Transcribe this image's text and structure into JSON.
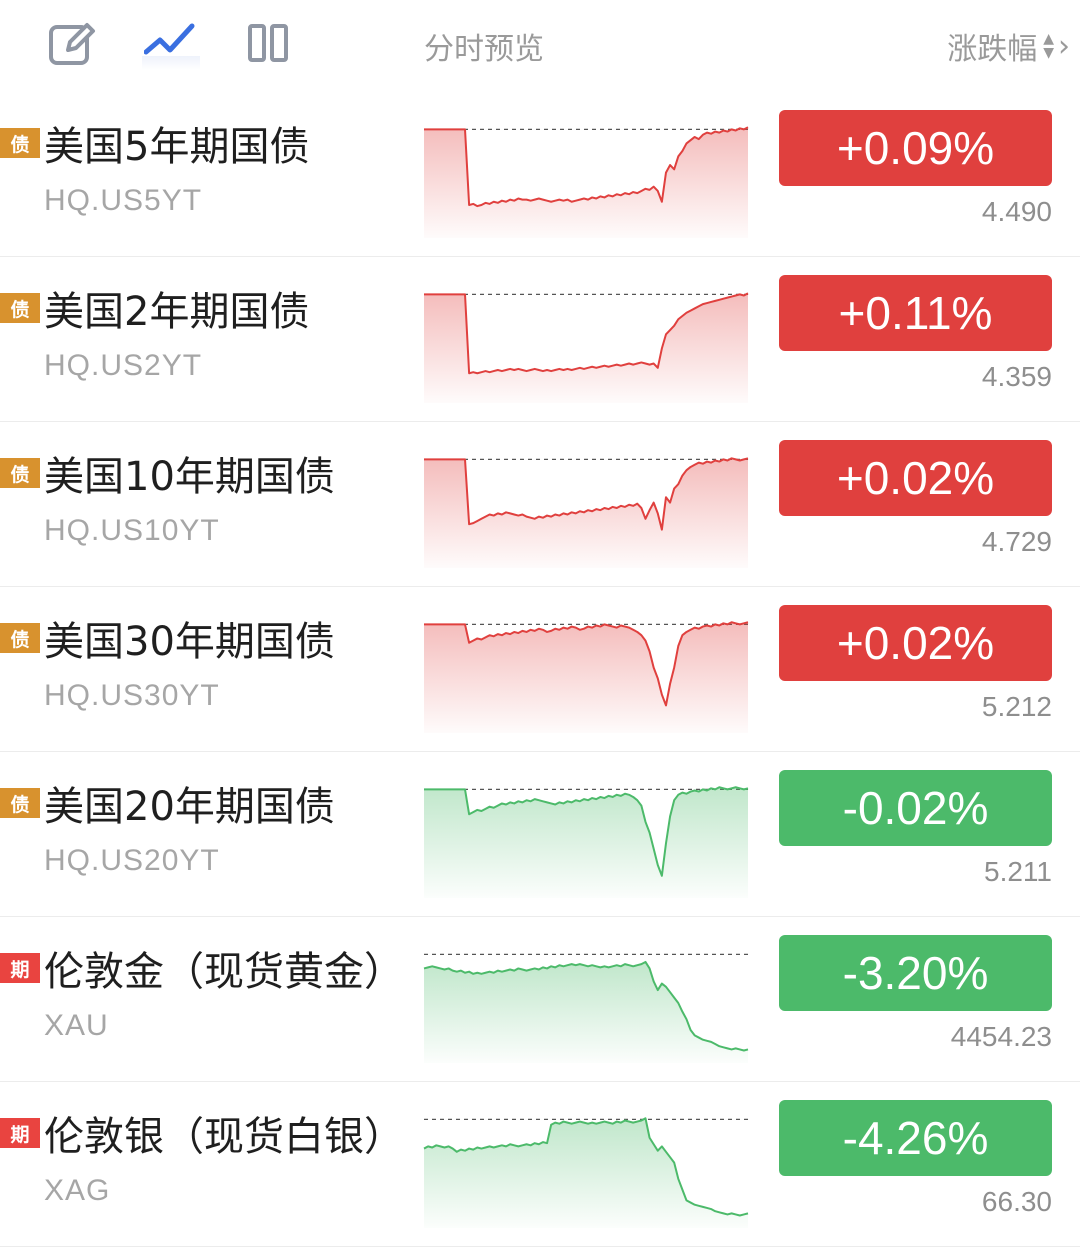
{
  "header": {
    "icons": [
      "edit-icon",
      "line-chart-icon",
      "columns-icon"
    ],
    "preview_label": "分时预览",
    "sort_label": "涨跌幅"
  },
  "colors": {
    "up": "#e0403e",
    "down": "#4cba6a",
    "bond_tag": "#d8922e",
    "futures_tag": "#e94440"
  },
  "rows": [
    {
      "tag": "债",
      "name": "美国5年期国债",
      "code": "HQ.US5YT",
      "change": "+0.09%",
      "price": "4.490",
      "direction": "up",
      "spark": [
        0.95,
        0.95,
        0.95,
        0.95,
        0.95,
        0.95,
        0.95,
        0.95,
        0.95,
        0.95,
        0.95,
        0.25,
        0.26,
        0.24,
        0.25,
        0.27,
        0.26,
        0.28,
        0.27,
        0.29,
        0.28,
        0.3,
        0.29,
        0.31,
        0.3,
        0.3,
        0.29,
        0.3,
        0.31,
        0.3,
        0.29,
        0.28,
        0.29,
        0.3,
        0.29,
        0.3,
        0.28,
        0.29,
        0.3,
        0.31,
        0.3,
        0.32,
        0.31,
        0.33,
        0.32,
        0.34,
        0.33,
        0.35,
        0.34,
        0.36,
        0.35,
        0.37,
        0.36,
        0.38,
        0.4,
        0.39,
        0.42,
        0.38,
        0.28,
        0.55,
        0.62,
        0.58,
        0.7,
        0.75,
        0.82,
        0.85,
        0.88,
        0.86,
        0.9,
        0.92,
        0.91,
        0.93,
        0.92,
        0.94,
        0.93,
        0.95,
        0.94,
        0.96,
        0.95,
        0.97
      ]
    },
    {
      "tag": "债",
      "name": "美国2年期国债",
      "code": "HQ.US2YT",
      "change": "+0.11%",
      "price": "4.359",
      "direction": "up",
      "spark": [
        0.95,
        0.95,
        0.95,
        0.95,
        0.95,
        0.95,
        0.95,
        0.95,
        0.95,
        0.95,
        0.95,
        0.22,
        0.23,
        0.22,
        0.23,
        0.24,
        0.23,
        0.24,
        0.25,
        0.24,
        0.25,
        0.26,
        0.25,
        0.26,
        0.25,
        0.24,
        0.25,
        0.26,
        0.25,
        0.24,
        0.25,
        0.24,
        0.25,
        0.26,
        0.25,
        0.26,
        0.25,
        0.26,
        0.27,
        0.26,
        0.27,
        0.28,
        0.27,
        0.28,
        0.29,
        0.28,
        0.29,
        0.3,
        0.29,
        0.3,
        0.31,
        0.3,
        0.31,
        0.32,
        0.31,
        0.3,
        0.31,
        0.27,
        0.45,
        0.58,
        0.62,
        0.66,
        0.72,
        0.75,
        0.78,
        0.8,
        0.82,
        0.84,
        0.86,
        0.87,
        0.88,
        0.89,
        0.9,
        0.91,
        0.92,
        0.93,
        0.94,
        0.95,
        0.94,
        0.96
      ]
    },
    {
      "tag": "债",
      "name": "美国10年期国债",
      "code": "HQ.US10YT",
      "change": "+0.02%",
      "price": "4.729",
      "direction": "up",
      "spark": [
        0.95,
        0.95,
        0.95,
        0.95,
        0.95,
        0.95,
        0.95,
        0.95,
        0.95,
        0.95,
        0.95,
        0.35,
        0.36,
        0.38,
        0.4,
        0.42,
        0.44,
        0.43,
        0.45,
        0.44,
        0.46,
        0.45,
        0.44,
        0.43,
        0.44,
        0.42,
        0.41,
        0.4,
        0.42,
        0.41,
        0.43,
        0.42,
        0.44,
        0.43,
        0.45,
        0.44,
        0.46,
        0.45,
        0.47,
        0.46,
        0.48,
        0.47,
        0.49,
        0.48,
        0.5,
        0.49,
        0.51,
        0.5,
        0.52,
        0.51,
        0.53,
        0.52,
        0.54,
        0.5,
        0.4,
        0.48,
        0.55,
        0.45,
        0.3,
        0.6,
        0.55,
        0.68,
        0.72,
        0.8,
        0.85,
        0.88,
        0.9,
        0.92,
        0.91,
        0.93,
        0.92,
        0.94,
        0.93,
        0.95,
        0.94,
        0.96,
        0.95,
        0.94,
        0.95,
        0.96
      ]
    },
    {
      "tag": "债",
      "name": "美国30年期国债",
      "code": "HQ.US30YT",
      "change": "+0.02%",
      "price": "5.212",
      "direction": "up",
      "spark": [
        0.95,
        0.95,
        0.95,
        0.95,
        0.95,
        0.95,
        0.95,
        0.95,
        0.95,
        0.95,
        0.95,
        0.78,
        0.8,
        0.82,
        0.81,
        0.83,
        0.85,
        0.84,
        0.86,
        0.85,
        0.87,
        0.86,
        0.88,
        0.87,
        0.89,
        0.88,
        0.9,
        0.89,
        0.91,
        0.9,
        0.88,
        0.89,
        0.91,
        0.9,
        0.92,
        0.91,
        0.93,
        0.92,
        0.9,
        0.91,
        0.93,
        0.92,
        0.94,
        0.93,
        0.95,
        0.94,
        0.93,
        0.92,
        0.94,
        0.93,
        0.92,
        0.9,
        0.88,
        0.85,
        0.8,
        0.7,
        0.55,
        0.45,
        0.3,
        0.2,
        0.4,
        0.55,
        0.75,
        0.85,
        0.88,
        0.9,
        0.92,
        0.91,
        0.93,
        0.94,
        0.93,
        0.95,
        0.94,
        0.96,
        0.95,
        0.97,
        0.96,
        0.95,
        0.96,
        0.97
      ]
    },
    {
      "tag": "债",
      "name": "美国20年期国债",
      "code": "HQ.US20YT",
      "change": "-0.02%",
      "price": "5.211",
      "direction": "down",
      "spark": [
        0.95,
        0.95,
        0.95,
        0.95,
        0.95,
        0.95,
        0.95,
        0.95,
        0.95,
        0.95,
        0.95,
        0.72,
        0.74,
        0.76,
        0.75,
        0.77,
        0.79,
        0.78,
        0.8,
        0.82,
        0.81,
        0.83,
        0.82,
        0.84,
        0.83,
        0.85,
        0.84,
        0.86,
        0.85,
        0.84,
        0.83,
        0.82,
        0.81,
        0.83,
        0.82,
        0.84,
        0.83,
        0.85,
        0.84,
        0.86,
        0.85,
        0.87,
        0.86,
        0.88,
        0.87,
        0.89,
        0.88,
        0.9,
        0.89,
        0.91,
        0.9,
        0.88,
        0.85,
        0.8,
        0.65,
        0.55,
        0.4,
        0.25,
        0.15,
        0.45,
        0.7,
        0.85,
        0.9,
        0.92,
        0.91,
        0.93,
        0.94,
        0.93,
        0.95,
        0.94,
        0.96,
        0.95,
        0.97,
        0.96,
        0.95,
        0.96,
        0.97,
        0.96,
        0.95,
        0.96
      ]
    },
    {
      "tag": "期",
      "name": "伦敦金（现货黄金）",
      "code": "XAU",
      "change": "-3.20%",
      "price": "4454.23",
      "direction": "down",
      "spark": [
        0.82,
        0.83,
        0.84,
        0.83,
        0.82,
        0.81,
        0.82,
        0.8,
        0.79,
        0.8,
        0.78,
        0.79,
        0.77,
        0.78,
        0.77,
        0.78,
        0.79,
        0.78,
        0.8,
        0.79,
        0.8,
        0.81,
        0.8,
        0.82,
        0.81,
        0.8,
        0.81,
        0.82,
        0.81,
        0.83,
        0.82,
        0.84,
        0.83,
        0.85,
        0.84,
        0.85,
        0.86,
        0.85,
        0.86,
        0.85,
        0.84,
        0.85,
        0.84,
        0.83,
        0.84,
        0.83,
        0.84,
        0.85,
        0.84,
        0.86,
        0.85,
        0.84,
        0.85,
        0.86,
        0.88,
        0.82,
        0.7,
        0.62,
        0.68,
        0.65,
        0.6,
        0.55,
        0.5,
        0.42,
        0.35,
        0.25,
        0.2,
        0.18,
        0.16,
        0.15,
        0.14,
        0.12,
        0.1,
        0.09,
        0.08,
        0.07,
        0.08,
        0.07,
        0.06,
        0.07
      ]
    },
    {
      "tag": "期",
      "name": "伦敦银（现货白银）",
      "code": "XAG",
      "change": "-4.26%",
      "price": "66.30",
      "direction": "down",
      "spark": [
        0.68,
        0.7,
        0.69,
        0.71,
        0.7,
        0.69,
        0.7,
        0.68,
        0.65,
        0.67,
        0.66,
        0.68,
        0.67,
        0.69,
        0.68,
        0.69,
        0.7,
        0.69,
        0.7,
        0.71,
        0.7,
        0.72,
        0.71,
        0.7,
        0.71,
        0.72,
        0.71,
        0.73,
        0.72,
        0.74,
        0.73,
        0.9,
        0.92,
        0.91,
        0.93,
        0.92,
        0.91,
        0.92,
        0.93,
        0.92,
        0.91,
        0.92,
        0.91,
        0.92,
        0.93,
        0.92,
        0.91,
        0.93,
        0.92,
        0.94,
        0.93,
        0.92,
        0.93,
        0.94,
        0.96,
        0.78,
        0.72,
        0.66,
        0.7,
        0.65,
        0.6,
        0.55,
        0.4,
        0.3,
        0.2,
        0.18,
        0.16,
        0.15,
        0.14,
        0.13,
        0.12,
        0.1,
        0.09,
        0.08,
        0.07,
        0.08,
        0.07,
        0.06,
        0.07,
        0.08
      ]
    }
  ]
}
